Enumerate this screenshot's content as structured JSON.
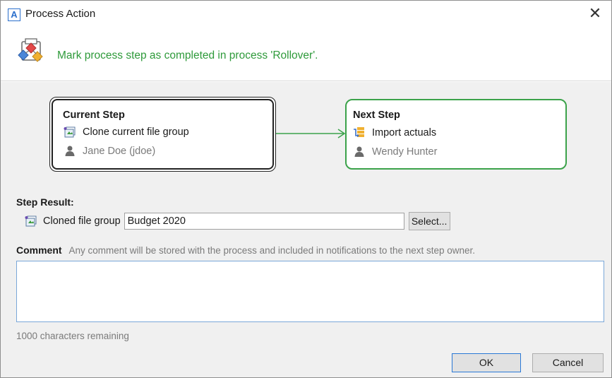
{
  "window": {
    "title": "Process Action",
    "app_icon_letter": "A",
    "close_glyph": "✕"
  },
  "header": {
    "message": "Mark process step as completed in process 'Rollover'.",
    "icon": "process-step-icon",
    "message_color": "#2e9a3a"
  },
  "current_step": {
    "title": "Current Step",
    "task": "Clone current file group",
    "task_icon": "clone-file-group-icon",
    "owner": "Jane Doe (jdoe)",
    "owner_icon": "user-icon"
  },
  "next_step": {
    "title": "Next Step",
    "task": "Import actuals",
    "task_icon": "import-actuals-icon",
    "owner": "Wendy Hunter",
    "owner_icon": "user-icon",
    "border_color": "#3ba24a"
  },
  "step_result": {
    "label": "Step Result:",
    "field_label": "Cloned file group",
    "field_icon": "file-group-icon",
    "value": "Budget 2020",
    "select_label": "Select..."
  },
  "comment": {
    "label": "Comment",
    "hint": "Any comment will be stored with the process and included in notifications to the next step owner.",
    "value": "",
    "remaining": "1000 characters remaining"
  },
  "buttons": {
    "ok": "OK",
    "cancel": "Cancel"
  },
  "colors": {
    "accent": "#2a78d6",
    "success": "#2e9a3a"
  }
}
